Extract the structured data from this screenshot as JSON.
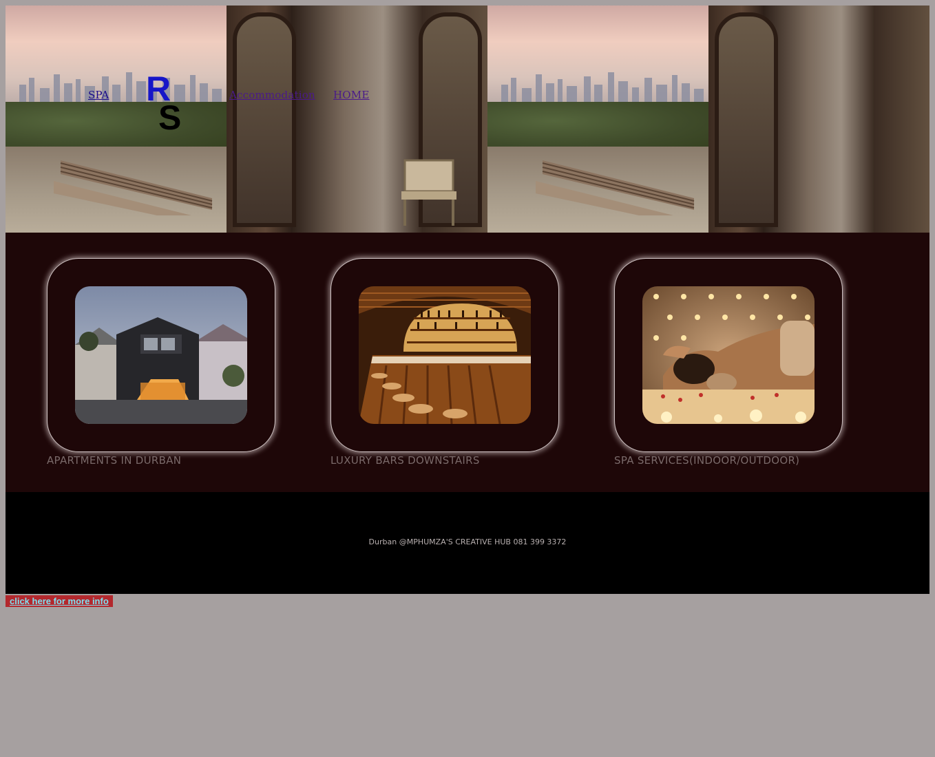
{
  "nav": {
    "spa": "SPA",
    "accommodation": "Accommodation",
    "home": "HOME",
    "logo_text": "RS"
  },
  "features": [
    {
      "caption": "APARTMENTS IN DURBAN",
      "image": "modern-house-photo"
    },
    {
      "caption": "LUXURY BARS DOWNSTAIRS",
      "image": "bar-interior-photo"
    },
    {
      "caption": "SPA SERVICES(INDOOR/OUTDOOR)",
      "image": "spa-massage-photo"
    }
  ],
  "footer": {
    "text": "Durban @MPHUMZA'S CREATIVE HUB 081 399 3372"
  },
  "more_button": {
    "label": "click here for more info"
  },
  "colors": {
    "page_bg": "#a6a0a0",
    "features_bg": "#1e0708",
    "footer_bg": "#000000",
    "button_bg": "#b3282d",
    "button_text": "#7fe0f0"
  }
}
